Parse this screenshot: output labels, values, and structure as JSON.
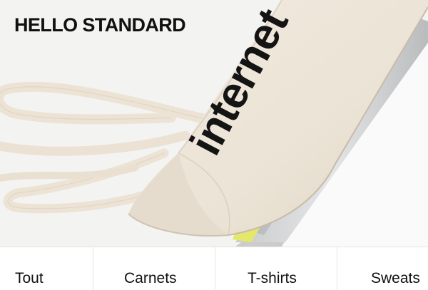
{
  "header": {
    "brand": "HELLO STANDARD"
  },
  "hero": {
    "image": "canvas-tote-bag-printed-internet",
    "bag_print": "internet",
    "colors": {
      "canvas": "#ede5d8",
      "canvas_shadow": "#d9cfbf",
      "background": "#f2f2f1",
      "print": "#141414"
    }
  },
  "nav": {
    "items": [
      {
        "label": "Tout"
      },
      {
        "label": "Carnets"
      },
      {
        "label": "T-shirts"
      },
      {
        "label": "Sweats"
      }
    ]
  }
}
